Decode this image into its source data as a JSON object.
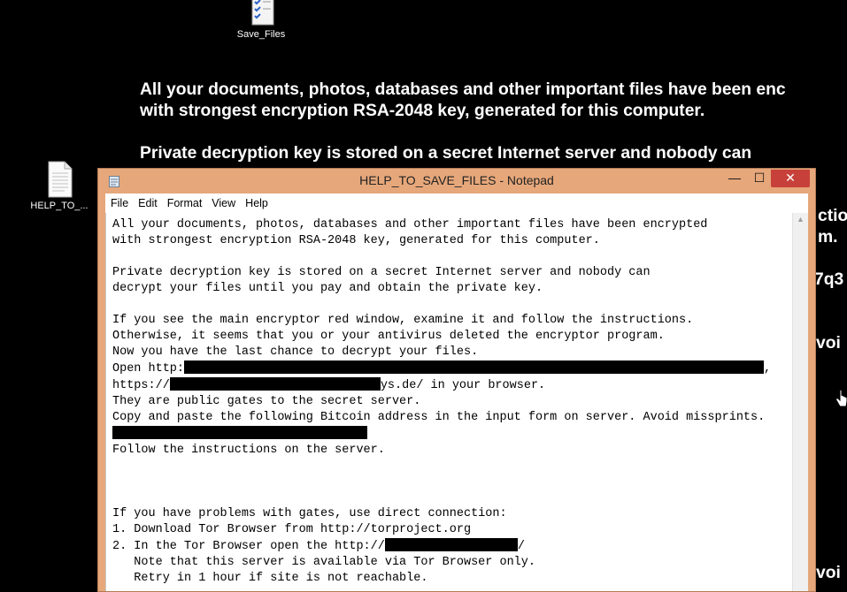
{
  "desktop": {
    "icons": [
      {
        "name": "save-files",
        "label": "Save_Files"
      },
      {
        "name": "help-to-save-files",
        "label": "HELP_TO_..."
      }
    ],
    "wallpaper_lines": [
      "All your documents, photos, databases and other important files have been enc",
      "with strongest encryption RSA-2048 key, generated for this computer.",
      "Private decryption key is stored on a secret Internet server and nobody can"
    ],
    "right_fragments": [
      "ctio",
      "m.",
      "7q3",
      "voi",
      "voi"
    ]
  },
  "window": {
    "title": "HELP_TO_SAVE_FILES - Notepad",
    "controls": {
      "minimize": "—",
      "maximize": "☐",
      "close": "✕"
    },
    "menu": [
      "File",
      "Edit",
      "Format",
      "View",
      "Help"
    ]
  },
  "note": {
    "l01": "All your documents, photos, databases and other important files have been encrypted",
    "l02": "with strongest encryption RSA-2048 key, generated for this computer.",
    "l04": "Private decryption key is stored on a secret Internet server and nobody can",
    "l05": "decrypt your files until you pay and obtain the private key.",
    "l07": "If you see the main encryptor red window, examine it and follow the instructions.",
    "l08": "Otherwise, it seems that you or your antivirus deleted the encryptor program.",
    "l09": "Now you have the last chance to decrypt your files.",
    "l10a": "Open http:",
    "l10b": ",",
    "l11a": "https://",
    "l11b": "ys.de/ in your browser.",
    "l12": "They are public gates to the secret server.",
    "l13": "Copy and paste the following Bitcoin address in the input form on server. Avoid missprints.",
    "l15": "Follow the instructions on the server.",
    "l19": "If you have problems with gates, use direct connection:",
    "l20": "1. Download Tor Browser from http://torproject.org",
    "l21a": "2. In the Tor Browser open the http://",
    "l21b": "/",
    "l22": "   Note that this server is available via Tor Browser only.",
    "l23": "   Retry in 1 hour if site is not reachable."
  }
}
